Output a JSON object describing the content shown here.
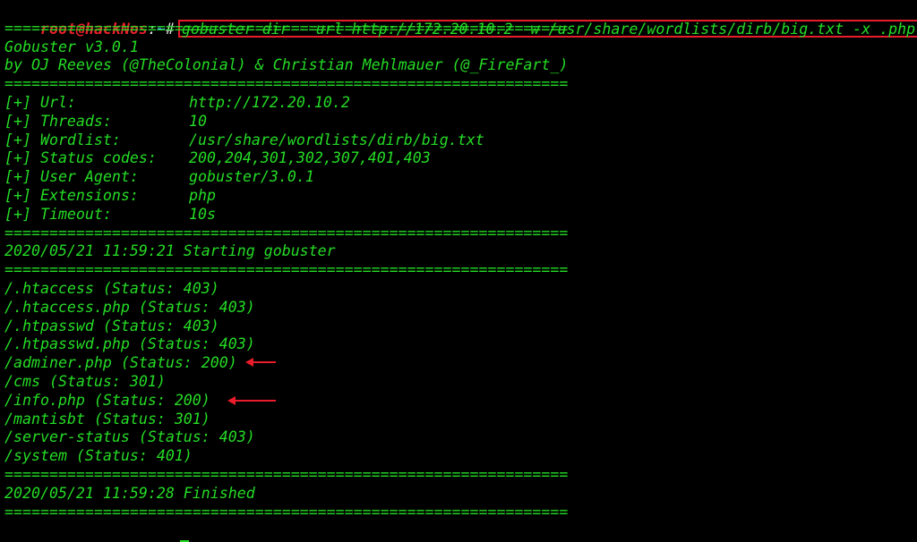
{
  "prompt": {
    "user_host": "root@hackNos",
    "separator": ":",
    "path": "~",
    "symbol": "#"
  },
  "command": "gobuster dir --url http://172.20.10.2 -w /usr/share/wordlists/dirb/big.txt -x .php",
  "separator_line": "===============================================================",
  "banner": {
    "title": "Gobuster v3.0.1",
    "authors": "by OJ Reeves (@TheColonial) & Christian Mehlmauer (@_FireFart_)"
  },
  "config": [
    {
      "label": "[+] Url:",
      "value": "http://172.20.10.2"
    },
    {
      "label": "[+] Threads:",
      "value": "10"
    },
    {
      "label": "[+] Wordlist:",
      "value": "/usr/share/wordlists/dirb/big.txt"
    },
    {
      "label": "[+] Status codes:",
      "value": "200,204,301,302,307,401,403"
    },
    {
      "label": "[+] User Agent:",
      "value": "gobuster/3.0.1"
    },
    {
      "label": "[+] Extensions:",
      "value": "php"
    },
    {
      "label": "[+] Timeout:",
      "value": "10s"
    }
  ],
  "start_message": "2020/05/21 11:59:21 Starting gobuster",
  "results": [
    "/.htaccess (Status: 403)",
    "/.htaccess.php (Status: 403)",
    "/.htpasswd (Status: 403)",
    "/.htpasswd.php (Status: 403)",
    "/adminer.php (Status: 200)",
    "/cms (Status: 301)",
    "/info.php (Status: 200)",
    "/mantisbt (Status: 301)",
    "/server-status (Status: 403)",
    "/system (Status: 401)"
  ],
  "finish_message": "2020/05/21 11:59:28 Finished",
  "colors": {
    "background": "#000000",
    "output_text": "#25dc25",
    "prompt_user": "#e8202a",
    "prompt_path": "#4a8cff",
    "annotation": "#e81c2a"
  }
}
